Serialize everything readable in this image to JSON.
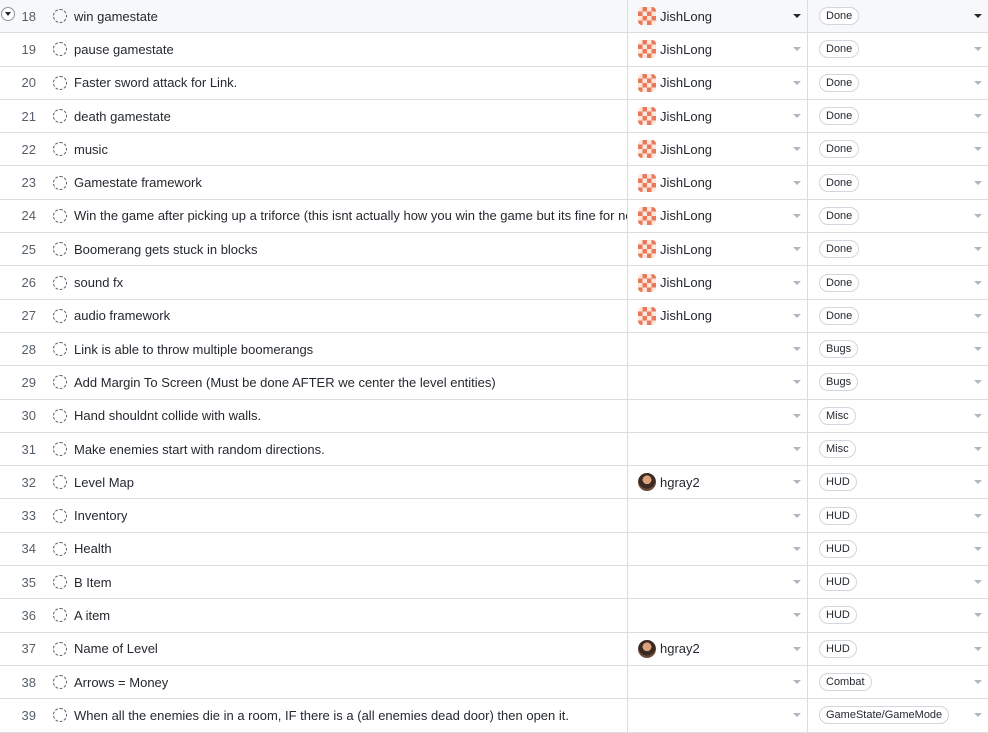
{
  "rows": [
    {
      "num": "18",
      "title": "win gamestate",
      "assignee": "JishLong",
      "avatar": "pixel",
      "status": "Done",
      "selected": true
    },
    {
      "num": "19",
      "title": "pause gamestate",
      "assignee": "JishLong",
      "avatar": "pixel",
      "status": "Done"
    },
    {
      "num": "20",
      "title": "Faster sword attack for Link.",
      "assignee": "JishLong",
      "avatar": "pixel",
      "status": "Done"
    },
    {
      "num": "21",
      "title": "death gamestate",
      "assignee": "JishLong",
      "avatar": "pixel",
      "status": "Done"
    },
    {
      "num": "22",
      "title": "music",
      "assignee": "JishLong",
      "avatar": "pixel",
      "status": "Done"
    },
    {
      "num": "23",
      "title": "Gamestate framework",
      "assignee": "JishLong",
      "avatar": "pixel",
      "status": "Done"
    },
    {
      "num": "24",
      "title": "Win the game after picking up a triforce (this isnt actually how you win the game but its fine for now)",
      "assignee": "JishLong",
      "avatar": "pixel",
      "status": "Done"
    },
    {
      "num": "25",
      "title": "Boomerang gets stuck in blocks",
      "assignee": "JishLong",
      "avatar": "pixel",
      "status": "Done"
    },
    {
      "num": "26",
      "title": "sound fx",
      "assignee": "JishLong",
      "avatar": "pixel",
      "status": "Done"
    },
    {
      "num": "27",
      "title": "audio framework",
      "assignee": "JishLong",
      "avatar": "pixel",
      "status": "Done"
    },
    {
      "num": "28",
      "title": "Link is able to throw multiple boomerangs",
      "assignee": "",
      "avatar": "",
      "status": "Bugs"
    },
    {
      "num": "29",
      "title": "Add Margin To Screen (Must be done AFTER we center the level entities)",
      "assignee": "",
      "avatar": "",
      "status": "Bugs"
    },
    {
      "num": "30",
      "title": "Hand shouldnt collide with walls.",
      "assignee": "",
      "avatar": "",
      "status": "Misc"
    },
    {
      "num": "31",
      "title": "Make enemies start with random directions.",
      "assignee": "",
      "avatar": "",
      "status": "Misc"
    },
    {
      "num": "32",
      "title": "Level Map",
      "assignee": "hgray2",
      "avatar": "photo",
      "status": "HUD"
    },
    {
      "num": "33",
      "title": "Inventory",
      "assignee": "",
      "avatar": "",
      "status": "HUD"
    },
    {
      "num": "34",
      "title": "Health",
      "assignee": "",
      "avatar": "",
      "status": "HUD"
    },
    {
      "num": "35",
      "title": "B Item",
      "assignee": "",
      "avatar": "",
      "status": "HUD"
    },
    {
      "num": "36",
      "title": "A item",
      "assignee": "",
      "avatar": "",
      "status": "HUD"
    },
    {
      "num": "37",
      "title": "Name of Level",
      "assignee": "hgray2",
      "avatar": "photo",
      "status": "HUD"
    },
    {
      "num": "38",
      "title": "Arrows = Money",
      "assignee": "",
      "avatar": "",
      "status": "Combat"
    },
    {
      "num": "39",
      "title": "When all the enemies die in a room, IF there is a (all enemies dead door) then open it.",
      "assignee": "",
      "avatar": "",
      "status": "GameState/GameMode"
    }
  ]
}
